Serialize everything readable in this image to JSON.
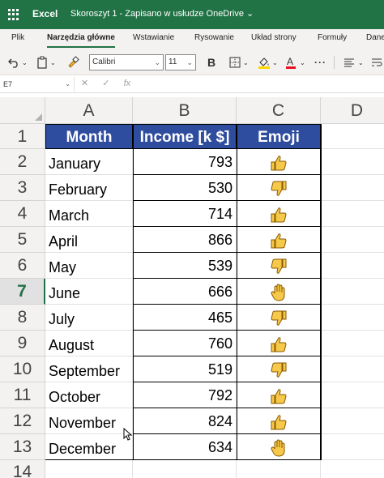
{
  "titlebar": {
    "app_name": "Excel",
    "doc_title": "Skoroszyt 1  -  Zapisano w usłudze OneDrive ⌄"
  },
  "tabs": [
    "Plik",
    "Narzędzia główne",
    "Wstawianie",
    "Rysowanie",
    "Układ strony",
    "Formuły",
    "Dane"
  ],
  "active_tab": "Narzędzia główne",
  "toolbar": {
    "font_name": "Calibri",
    "font_size": "11",
    "bold_label": "B",
    "more_label": "···"
  },
  "formula_bar": {
    "name_box": "E7",
    "cancel_glyph": "✕",
    "enter_glyph": "✓",
    "fx_label": "fx"
  },
  "grid": {
    "columns": [
      "A",
      "B",
      "C",
      "D"
    ],
    "rows": [
      "1",
      "2",
      "3",
      "4",
      "5",
      "6",
      "7",
      "8",
      "9",
      "10",
      "11",
      "12",
      "13",
      "14"
    ],
    "active_row": "7",
    "headers": {
      "month": "Month",
      "income": "Income [k $]",
      "emoji": "Emoji"
    },
    "data": [
      {
        "month": "January",
        "income": "793",
        "emoji": "thumbs-up-icon"
      },
      {
        "month": "February",
        "income": "530",
        "emoji": "thumbs-down-icon"
      },
      {
        "month": "March",
        "income": "714",
        "emoji": "thumbs-up-icon"
      },
      {
        "month": "April",
        "income": "866",
        "emoji": "thumbs-up-icon"
      },
      {
        "month": "May",
        "income": "539",
        "emoji": "thumbs-down-icon"
      },
      {
        "month": "June",
        "income": "666",
        "emoji": "raised-hand-icon"
      },
      {
        "month": "July",
        "income": "465",
        "emoji": "thumbs-down-icon"
      },
      {
        "month": "August",
        "income": "760",
        "emoji": "thumbs-up-icon"
      },
      {
        "month": "September",
        "income": "519",
        "emoji": "thumbs-down-icon"
      },
      {
        "month": "October",
        "income": "792",
        "emoji": "thumbs-up-icon"
      },
      {
        "month": "November",
        "income": "824",
        "emoji": "thumbs-up-icon"
      },
      {
        "month": "December",
        "income": "634",
        "emoji": "raised-hand-icon"
      }
    ]
  },
  "colors": {
    "excel_green": "#217346",
    "header_blue": "#2f4d9f",
    "emoji_yellow": "#f6c94a",
    "emoji_outline": "#8a5a00"
  }
}
